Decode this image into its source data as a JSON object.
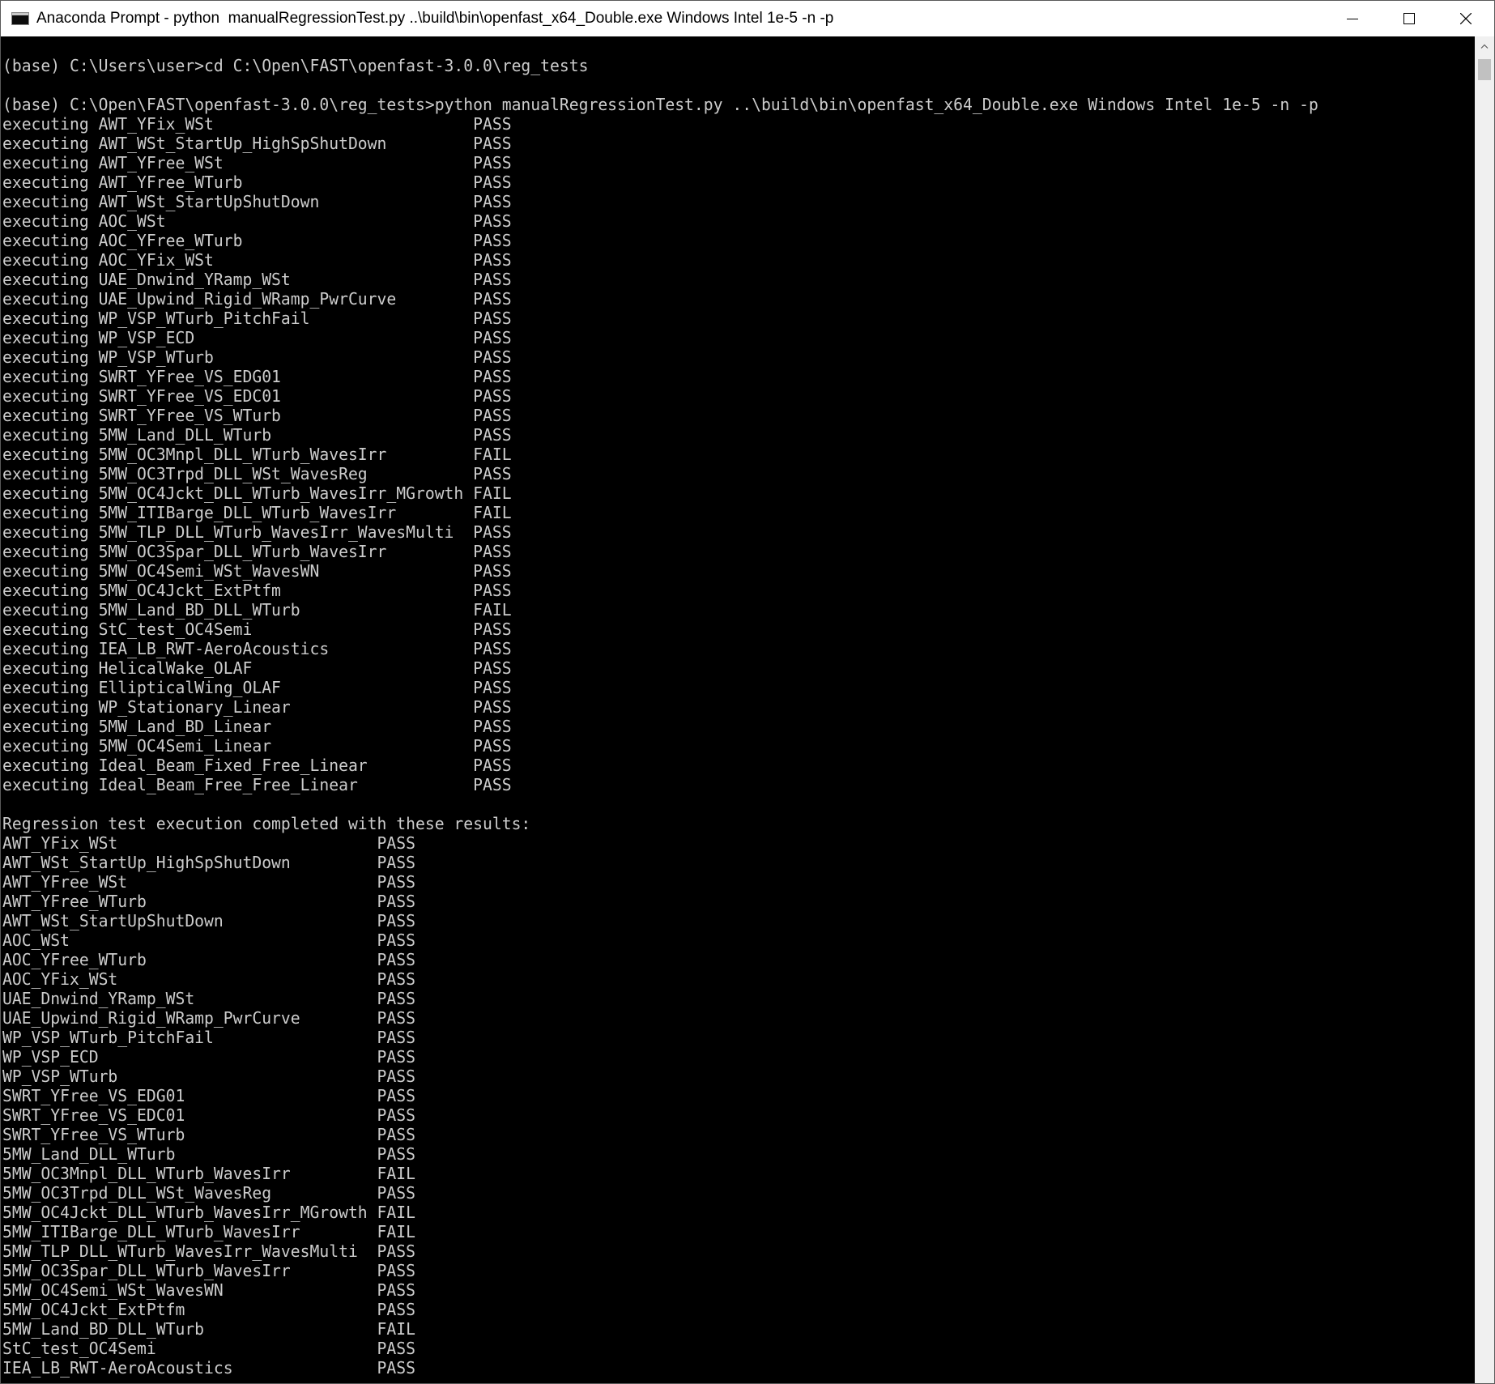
{
  "window": {
    "title": "Anaconda Prompt - python  manualRegressionTest.py ..\\build\\bin\\openfast_x64_Double.exe Windows Intel 1e-5 -n -p"
  },
  "icons": {
    "app": "console-icon",
    "minimize": "minimize-icon",
    "maximize": "maximize-icon",
    "close": "close-icon",
    "scroll_up": "scroll-up-arrow-icon"
  },
  "console": {
    "lines": [
      "",
      "(base) C:\\Users\\user>cd C:\\Open\\FAST\\openfast-3.0.0\\reg_tests",
      "",
      "(base) C:\\Open\\FAST\\openfast-3.0.0\\reg_tests>python manualRegressionTest.py ..\\build\\bin\\openfast_x64_Double.exe Windows Intel 1e-5 -n -p",
      "executing AWT_YFix_WSt                           PASS",
      "executing AWT_WSt_StartUp_HighSpShutDown         PASS",
      "executing AWT_YFree_WSt                          PASS",
      "executing AWT_YFree_WTurb                        PASS",
      "executing AWT_WSt_StartUpShutDown                PASS",
      "executing AOC_WSt                                PASS",
      "executing AOC_YFree_WTurb                        PASS",
      "executing AOC_YFix_WSt                           PASS",
      "executing UAE_Dnwind_YRamp_WSt                   PASS",
      "executing UAE_Upwind_Rigid_WRamp_PwrCurve        PASS",
      "executing WP_VSP_WTurb_PitchFail                 PASS",
      "executing WP_VSP_ECD                             PASS",
      "executing WP_VSP_WTurb                           PASS",
      "executing SWRT_YFree_VS_EDG01                    PASS",
      "executing SWRT_YFree_VS_EDC01                    PASS",
      "executing SWRT_YFree_VS_WTurb                    PASS",
      "executing 5MW_Land_DLL_WTurb                     PASS",
      "executing 5MW_OC3Mnpl_DLL_WTurb_WavesIrr         FAIL",
      "executing 5MW_OC3Trpd_DLL_WSt_WavesReg           PASS",
      "executing 5MW_OC4Jckt_DLL_WTurb_WavesIrr_MGrowth FAIL",
      "executing 5MW_ITIBarge_DLL_WTurb_WavesIrr        FAIL",
      "executing 5MW_TLP_DLL_WTurb_WavesIrr_WavesMulti  PASS",
      "executing 5MW_OC3Spar_DLL_WTurb_WavesIrr         PASS",
      "executing 5MW_OC4Semi_WSt_WavesWN                PASS",
      "executing 5MW_OC4Jckt_ExtPtfm                    PASS",
      "executing 5MW_Land_BD_DLL_WTurb                  FAIL",
      "executing StC_test_OC4Semi                       PASS",
      "executing IEA_LB_RWT-AeroAcoustics               PASS",
      "executing HelicalWake_OLAF                       PASS",
      "executing EllipticalWing_OLAF                    PASS",
      "executing WP_Stationary_Linear                   PASS",
      "executing 5MW_Land_BD_Linear                     PASS",
      "executing 5MW_OC4Semi_Linear                     PASS",
      "executing Ideal_Beam_Fixed_Free_Linear           PASS",
      "executing Ideal_Beam_Free_Free_Linear            PASS",
      "",
      "Regression test execution completed with these results:",
      "AWT_YFix_WSt                           PASS",
      "AWT_WSt_StartUp_HighSpShutDown         PASS",
      "AWT_YFree_WSt                          PASS",
      "AWT_YFree_WTurb                        PASS",
      "AWT_WSt_StartUpShutDown                PASS",
      "AOC_WSt                                PASS",
      "AOC_YFree_WTurb                        PASS",
      "AOC_YFix_WSt                           PASS",
      "UAE_Dnwind_YRamp_WSt                   PASS",
      "UAE_Upwind_Rigid_WRamp_PwrCurve        PASS",
      "WP_VSP_WTurb_PitchFail                 PASS",
      "WP_VSP_ECD                             PASS",
      "WP_VSP_WTurb                           PASS",
      "SWRT_YFree_VS_EDG01                    PASS",
      "SWRT_YFree_VS_EDC01                    PASS",
      "SWRT_YFree_VS_WTurb                    PASS",
      "5MW_Land_DLL_WTurb                     PASS",
      "5MW_OC3Mnpl_DLL_WTurb_WavesIrr         FAIL",
      "5MW_OC3Trpd_DLL_WSt_WavesReg           PASS",
      "5MW_OC4Jckt_DLL_WTurb_WavesIrr_MGrowth FAIL",
      "5MW_ITIBarge_DLL_WTurb_WavesIrr        FAIL",
      "5MW_TLP_DLL_WTurb_WavesIrr_WavesMulti  PASS",
      "5MW_OC3Spar_DLL_WTurb_WavesIrr         PASS",
      "5MW_OC4Semi_WSt_WavesWN                PASS",
      "5MW_OC4Jckt_ExtPtfm                    PASS",
      "5MW_Land_BD_DLL_WTurb                  FAIL",
      "StC_test_OC4Semi                       PASS",
      "IEA_LB_RWT-AeroAcoustics               PASS"
    ]
  }
}
